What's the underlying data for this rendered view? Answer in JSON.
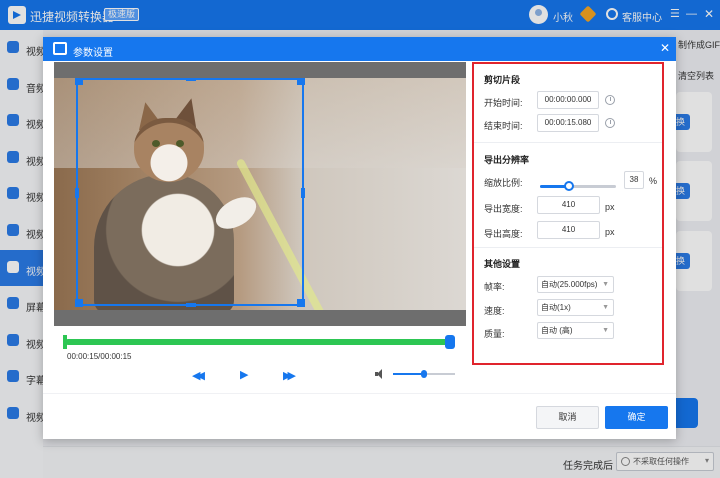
{
  "app": {
    "title": "迅捷视频转换器",
    "badge": "极速版",
    "user_name": "小秋",
    "support": "客服中心",
    "menu_glyph": "☰",
    "minimize_glyph": "—",
    "close_glyph": "✕"
  },
  "sidebar": {
    "items": [
      {
        "label": "视频"
      },
      {
        "label": "音频"
      },
      {
        "label": "视频"
      },
      {
        "label": "视频"
      },
      {
        "label": "视频"
      },
      {
        "label": "视频"
      },
      {
        "label": "视频"
      },
      {
        "label": "屏幕"
      },
      {
        "label": "视频"
      },
      {
        "label": "字幕"
      },
      {
        "label": "视频"
      }
    ],
    "active_index": 6
  },
  "background": {
    "gif_text": "制作成GIF",
    "clear_text": "清空列表",
    "card_button": "换",
    "task_label": "任务完成后",
    "task_select": "不采取任何操作"
  },
  "dialog": {
    "title": "参数设置",
    "close_glyph": "✕",
    "time_display": "00:00:15/00:00:15",
    "rewind_glyph": "◀◀",
    "play_glyph": "▶",
    "forward_glyph": "▶▶",
    "volume_level": 0.5,
    "clip_section": {
      "title": "剪切片段",
      "start_label": "开始时间:",
      "start_value": "00:00:00.000",
      "end_label": "结束时间:",
      "end_value": "00:00:15.080"
    },
    "resolution_section": {
      "title": "导出分辨率",
      "scale_label": "缩放比例:",
      "scale_value": "38",
      "scale_unit": "%",
      "width_label": "导出宽度:",
      "width_value": "410",
      "width_unit": "px",
      "height_label": "导出高度:",
      "height_value": "410",
      "height_unit": "px"
    },
    "other_section": {
      "title": "其他设置",
      "fps_label": "帧率:",
      "fps_value": "自动(25.000fps)",
      "speed_label": "速度:",
      "speed_value": "自动(1x)",
      "quality_label": "质量:",
      "quality_value": "自动 (高)"
    },
    "cancel_label": "取消",
    "ok_label": "确定"
  },
  "colors": {
    "accent": "#1677ee",
    "timeline": "#2dc653",
    "highlight_border": "#e0242d"
  }
}
